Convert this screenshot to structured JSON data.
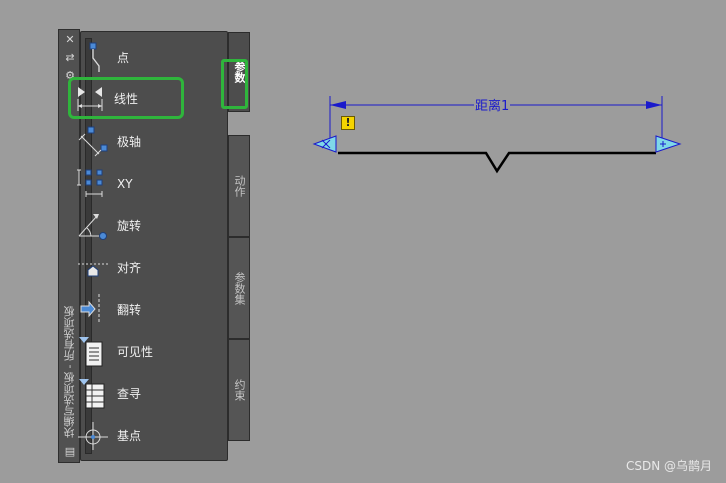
{
  "palette": {
    "title": "块编写选项板 - 所有选项板",
    "items": [
      {
        "label": "点",
        "icon": "point-parameter-icon"
      },
      {
        "label": "线性",
        "icon": "linear-parameter-icon"
      },
      {
        "label": "极轴",
        "icon": "polar-parameter-icon"
      },
      {
        "label": "XY",
        "icon": "xy-parameter-icon"
      },
      {
        "label": "旋转",
        "icon": "rotation-parameter-icon"
      },
      {
        "label": "对齐",
        "icon": "alignment-parameter-icon"
      },
      {
        "label": "翻转",
        "icon": "flip-parameter-icon"
      },
      {
        "label": "可见性",
        "icon": "visibility-parameter-icon"
      },
      {
        "label": "查寻",
        "icon": "lookup-parameter-icon"
      },
      {
        "label": "基点",
        "icon": "basepoint-parameter-icon"
      }
    ],
    "tabs": [
      {
        "label": "参数",
        "active": true
      },
      {
        "label": "动作",
        "active": false
      },
      {
        "label": "参数集",
        "active": false
      },
      {
        "label": "约束",
        "active": false
      }
    ]
  },
  "drawing": {
    "dimension_label": "距离1",
    "warning_symbol": "!"
  },
  "watermark": "CSDN @乌鹊月",
  "colors": {
    "canvas": "#9c9c9c",
    "panel": "#4d4d4d",
    "highlight": "#2fb53c",
    "dimension": "#1a1acc",
    "grip": "#7fd8e8",
    "warning": "#f5d400"
  }
}
